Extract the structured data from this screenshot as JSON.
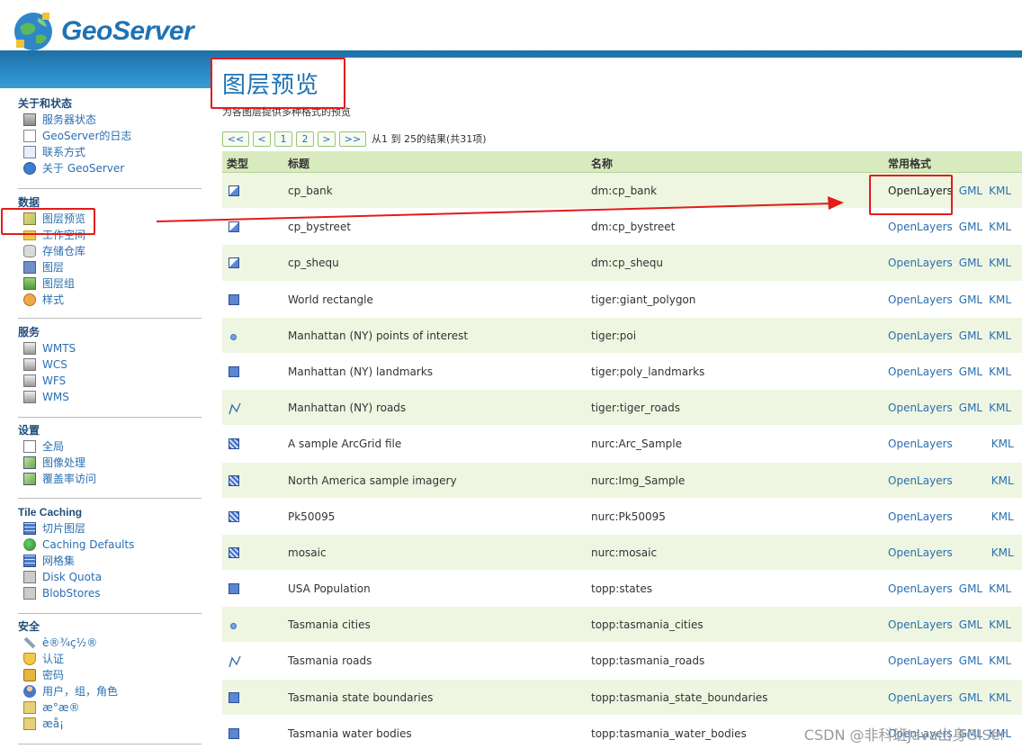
{
  "header": {
    "logo_text": "GeoServer"
  },
  "sidebar": {
    "sections": [
      {
        "title": "关于和状态",
        "items": [
          {
            "label": "服务器状态",
            "icon": "server-status-icon"
          },
          {
            "label": "GeoServer的日志",
            "icon": "log-document-icon"
          },
          {
            "label": "联系方式",
            "icon": "contact-card-icon"
          },
          {
            "label": "关于 GeoServer",
            "icon": "info-icon"
          }
        ]
      },
      {
        "title": "数据",
        "items": [
          {
            "label": "图层预览",
            "icon": "layer-preview-icon"
          },
          {
            "label": "工作空间",
            "icon": "folder-icon"
          },
          {
            "label": "存储仓库",
            "icon": "database-icon"
          },
          {
            "label": "图层",
            "icon": "layer-icon"
          },
          {
            "label": "图层组",
            "icon": "layer-group-icon"
          },
          {
            "label": "样式",
            "icon": "style-icon"
          }
        ]
      },
      {
        "title": "服务",
        "items": [
          {
            "label": "WMTS",
            "icon": "service-icon"
          },
          {
            "label": "WCS",
            "icon": "service-icon"
          },
          {
            "label": "WFS",
            "icon": "service-icon"
          },
          {
            "label": "WMS",
            "icon": "service-icon"
          }
        ]
      },
      {
        "title": "设置",
        "items": [
          {
            "label": "全局",
            "icon": "global-settings-icon"
          },
          {
            "label": "图像处理",
            "icon": "image-processing-icon"
          },
          {
            "label": "覆盖率访问",
            "icon": "coverage-access-icon"
          }
        ]
      },
      {
        "title": "Tile Caching",
        "items": [
          {
            "label": "切片图层",
            "icon": "tile-layers-icon"
          },
          {
            "label": "Caching Defaults",
            "icon": "globe-icon"
          },
          {
            "label": "网格集",
            "icon": "gridset-icon"
          },
          {
            "label": "Disk Quota",
            "icon": "disk-icon"
          },
          {
            "label": "BlobStores",
            "icon": "blobstore-icon"
          }
        ]
      },
      {
        "title": "安全",
        "items": [
          {
            "label": "è®¾ç½®",
            "icon": "wrench-icon"
          },
          {
            "label": "认证",
            "icon": "shield-icon"
          },
          {
            "label": "密码",
            "icon": "lock-icon"
          },
          {
            "label": "用户，组，角色",
            "icon": "users-icon"
          },
          {
            "label": "æ°æ®",
            "icon": "data-security-icon"
          },
          {
            "label": "æå¡",
            "icon": "service-security-icon"
          }
        ]
      }
    ]
  },
  "main": {
    "title": "图层预览",
    "description": "为各图层提供多种格式的预览",
    "pager": {
      "buttons": [
        "<<",
        "<",
        "1",
        "2",
        ">",
        ">>"
      ],
      "info": "从1 到 25的结果(共31项)"
    },
    "columns": {
      "type": "类型",
      "title": "标题",
      "name": "名称",
      "formats": "常用格式"
    },
    "rows": [
      {
        "type": "polygon-half",
        "title": "cp_bank",
        "name": "dm:cp_bank",
        "formats": [
          "OpenLayers",
          "GML",
          "KML"
        ]
      },
      {
        "type": "polygon-half",
        "title": "cp_bystreet",
        "name": "dm:cp_bystreet",
        "formats": [
          "OpenLayers",
          "GML",
          "KML"
        ]
      },
      {
        "type": "polygon-half",
        "title": "cp_shequ",
        "name": "dm:cp_shequ",
        "formats": [
          "OpenLayers",
          "GML",
          "KML"
        ]
      },
      {
        "type": "polygon",
        "title": "World rectangle",
        "name": "tiger:giant_polygon",
        "formats": [
          "OpenLayers",
          "GML",
          "KML"
        ]
      },
      {
        "type": "point",
        "title": "Manhattan (NY) points of interest",
        "name": "tiger:poi",
        "formats": [
          "OpenLayers",
          "GML",
          "KML"
        ]
      },
      {
        "type": "polygon",
        "title": "Manhattan (NY) landmarks",
        "name": "tiger:poly_landmarks",
        "formats": [
          "OpenLayers",
          "GML",
          "KML"
        ]
      },
      {
        "type": "line",
        "title": "Manhattan (NY) roads",
        "name": "tiger:tiger_roads",
        "formats": [
          "OpenLayers",
          "GML",
          "KML"
        ]
      },
      {
        "type": "raster",
        "title": "A sample ArcGrid file",
        "name": "nurc:Arc_Sample",
        "formats": [
          "OpenLayers",
          "KML"
        ]
      },
      {
        "type": "raster",
        "title": "North America sample imagery",
        "name": "nurc:Img_Sample",
        "formats": [
          "OpenLayers",
          "KML"
        ]
      },
      {
        "type": "raster",
        "title": "Pk50095",
        "name": "nurc:Pk50095",
        "formats": [
          "OpenLayers",
          "KML"
        ]
      },
      {
        "type": "raster",
        "title": "mosaic",
        "name": "nurc:mosaic",
        "formats": [
          "OpenLayers",
          "KML"
        ]
      },
      {
        "type": "polygon",
        "title": "USA Population",
        "name": "topp:states",
        "formats": [
          "OpenLayers",
          "GML",
          "KML"
        ]
      },
      {
        "type": "point",
        "title": "Tasmania cities",
        "name": "topp:tasmania_cities",
        "formats": [
          "OpenLayers",
          "GML",
          "KML"
        ]
      },
      {
        "type": "line",
        "title": "Tasmania roads",
        "name": "topp:tasmania_roads",
        "formats": [
          "OpenLayers",
          "GML",
          "KML"
        ]
      },
      {
        "type": "polygon",
        "title": "Tasmania state boundaries",
        "name": "topp:tasmania_state_boundaries",
        "formats": [
          "OpenLayers",
          "GML",
          "KML"
        ]
      },
      {
        "type": "polygon",
        "title": "Tasmania water bodies",
        "name": "topp:tasmania_water_bodies",
        "formats": [
          "OpenLayers",
          "GML",
          "KML"
        ]
      }
    ]
  },
  "watermark": "CSDN @非科班Java出身GISer",
  "colors": {
    "accent": "#1f73b4",
    "link": "#2a6fb0",
    "header_row": "#d8ebbf",
    "row_alt": "#eef6e2",
    "annotation": "#e31b1b"
  }
}
